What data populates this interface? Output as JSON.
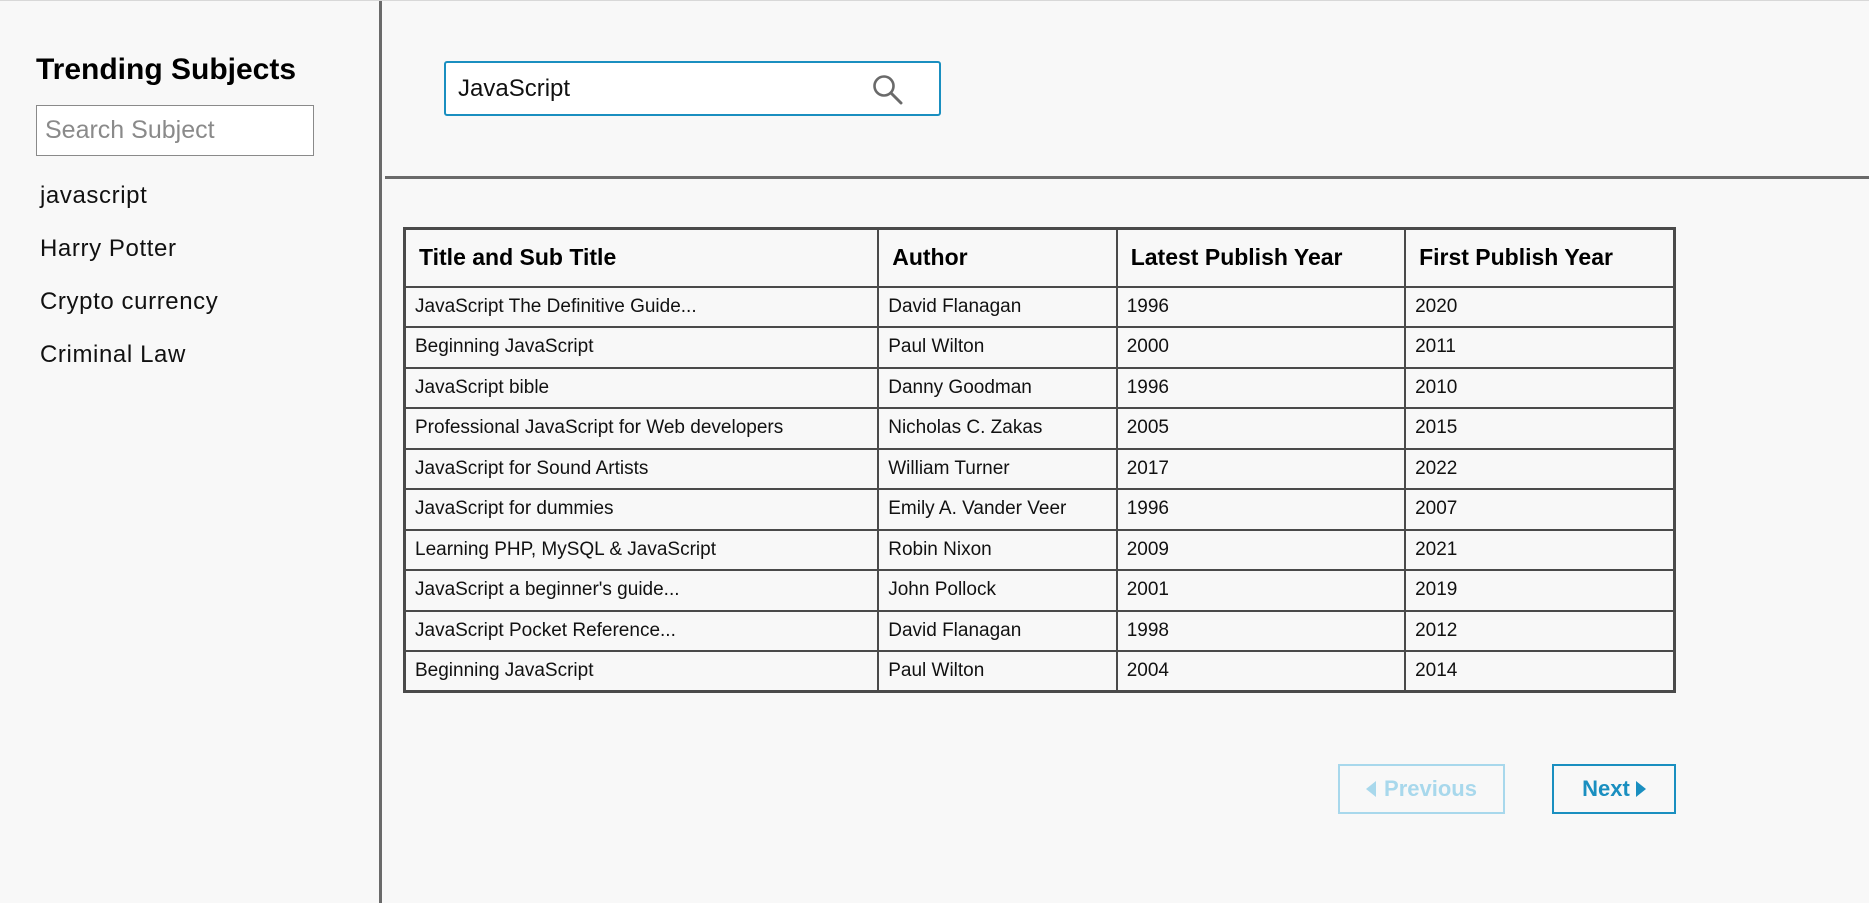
{
  "sidebar": {
    "title": "Trending Subjects",
    "search_placeholder": "Search Subject",
    "items": [
      {
        "label": "javascript"
      },
      {
        "label": "Harry Potter"
      },
      {
        "label": "Crypto currency"
      },
      {
        "label": "Criminal Law"
      }
    ]
  },
  "search": {
    "value": "JavaScript",
    "icon": "search-icon"
  },
  "table": {
    "headers": [
      "Title and Sub Title",
      "Author",
      "Latest Publish Year",
      "First Publish Year"
    ],
    "rows": [
      [
        "JavaScript The Definitive Guide...",
        "David Flanagan",
        "1996",
        "2020"
      ],
      [
        "Beginning JavaScript",
        "Paul Wilton",
        "2000",
        "2011"
      ],
      [
        "JavaScript bible",
        "Danny Goodman",
        "1996",
        "2010"
      ],
      [
        "Professional JavaScript for Web developers",
        "Nicholas C. Zakas",
        "2005",
        "2015"
      ],
      [
        "JavaScript for Sound Artists",
        "William Turner",
        "2017",
        "2022"
      ],
      [
        "JavaScript for dummies",
        "Emily A. Vander Veer",
        "1996",
        "2007"
      ],
      [
        "Learning PHP, MySQL & JavaScript",
        "Robin Nixon",
        "2009",
        "2021"
      ],
      [
        "JavaScript a beginner's guide...",
        "John Pollock",
        "2001",
        "2019"
      ],
      [
        "JavaScript Pocket Reference...",
        "David Flanagan",
        "1998",
        "2012"
      ],
      [
        "Beginning JavaScript",
        "Paul Wilton",
        "2004",
        "2014"
      ]
    ]
  },
  "pagination": {
    "previous_label": "Previous",
    "next_label": "Next",
    "previous_disabled": true
  },
  "colors": {
    "accent": "#1a8fc0",
    "accent_disabled": "#a8d8ec",
    "divider": "#6a6a6a",
    "table_border": "#4a4a4a",
    "background": "#f8f8f8"
  }
}
